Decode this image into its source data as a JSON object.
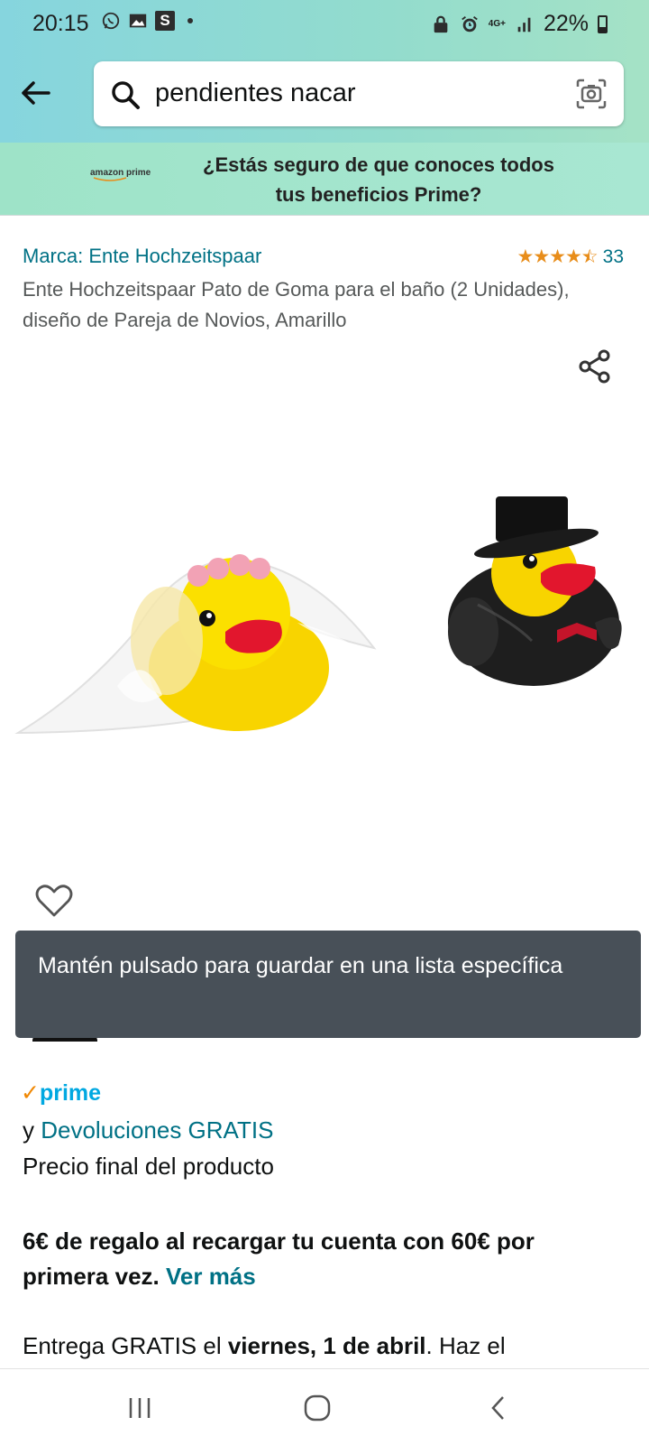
{
  "status_bar": {
    "time": "20:15",
    "network": "4G+",
    "battery": "22%",
    "icons": [
      "whatsapp-icon",
      "gallery-icon",
      "s-app-icon",
      "lock-icon",
      "alarm-icon",
      "signal-icon",
      "battery-icon"
    ]
  },
  "search": {
    "query": "pendientes nacar"
  },
  "prime_banner": {
    "logo_text": "amazon prime",
    "line1": "¿Estás seguro de que conoces todos",
    "line2": "tus beneficios Prime?"
  },
  "product": {
    "brand": "Marca: Ente Hochzeitspaar",
    "rating_count": "33",
    "rating_value": 4.5,
    "title": "Ente Hochzeitspaar Pato de Goma para el baño (2 Unidades), diseño de Pareja de Novios, Amarillo"
  },
  "tooltip": {
    "text": "Mantén pulsado para guardar en una lista específica"
  },
  "pricing": {
    "prime_label": "prime",
    "returns_prefix": "y ",
    "returns_link": "Devoluciones GRATIS",
    "final_price": "Precio final del producto"
  },
  "promo": {
    "text": "6€ de regalo al recargar tu cuenta con 60€ por primera vez. ",
    "link": "Ver más"
  },
  "delivery": {
    "prefix": "Entrega GRATIS el ",
    "date": "viernes, 1 de abril",
    "suffix": ". Haz el"
  },
  "colors": {
    "link": "#007185",
    "star": "#e88d1a",
    "prime_blue": "#00a8e1",
    "tooltip_bg": "#485058"
  }
}
